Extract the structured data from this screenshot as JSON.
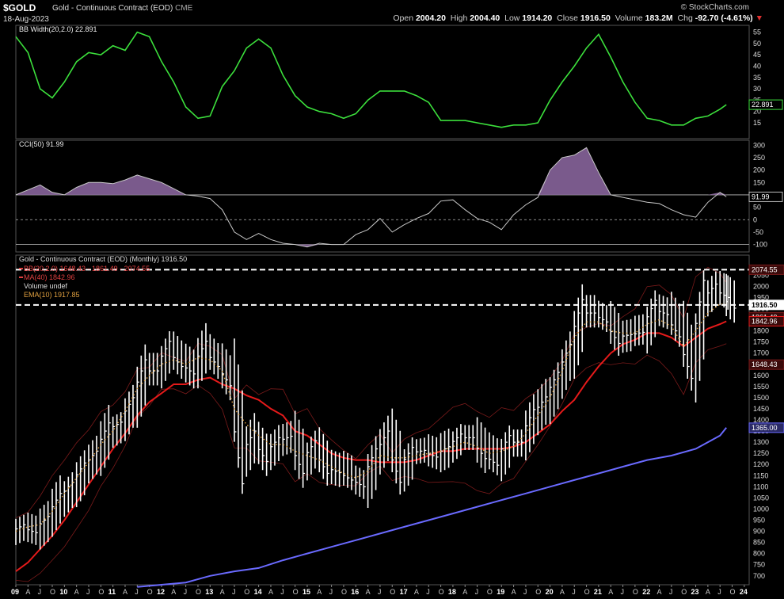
{
  "header": {
    "symbol": "$GOLD",
    "name": "Gold - Continuous Contract (EOD)",
    "exchange": "CME",
    "date": "18-Aug-2023",
    "logo": "© StockCharts.com",
    "ohlc": {
      "open_label": "Open",
      "open": "2004.20",
      "high_label": "High",
      "high": "2004.40",
      "low_label": "Low",
      "low": "1914.20",
      "close_label": "Close",
      "close": "1916.50",
      "volume_label": "Volume",
      "volume": "183.2M",
      "chg_label": "Chg",
      "chg": "-92.70 (-4.61%)"
    },
    "down_arrow_color": "#e03030"
  },
  "chart_data": [
    {
      "type": "line",
      "panel": "BB Width",
      "legend": "BB Width(20,2.0) 22.891",
      "last_value_label": "22.891",
      "color": "#3ce03c",
      "ylim": [
        8,
        58
      ],
      "yticks": [
        15,
        20,
        25,
        30,
        35,
        40,
        45,
        50,
        55
      ],
      "x": [
        2009.0,
        2009.25,
        2009.5,
        2009.75,
        2010.0,
        2010.25,
        2010.5,
        2010.75,
        2011.0,
        2011.25,
        2011.5,
        2011.75,
        2012.0,
        2012.25,
        2012.5,
        2012.75,
        2013.0,
        2013.25,
        2013.5,
        2013.75,
        2014.0,
        2014.25,
        2014.5,
        2014.75,
        2015.0,
        2015.25,
        2015.5,
        2015.75,
        2016.0,
        2016.25,
        2016.5,
        2016.75,
        2017.0,
        2017.25,
        2017.5,
        2017.75,
        2018.0,
        2018.25,
        2018.5,
        2018.75,
        2019.0,
        2019.25,
        2019.5,
        2019.75,
        2020.0,
        2020.25,
        2020.5,
        2020.75,
        2021.0,
        2021.25,
        2021.5,
        2021.75,
        2022.0,
        2022.25,
        2022.5,
        2022.75,
        2023.0,
        2023.25,
        2023.5,
        2023.63
      ],
      "y": [
        53,
        46,
        30,
        26,
        33,
        42,
        46,
        45,
        49,
        47,
        55,
        53,
        42,
        33,
        22,
        17,
        18,
        31,
        38,
        48,
        52,
        48,
        36,
        27,
        22,
        20,
        19,
        17,
        19,
        25,
        29,
        29,
        29,
        27,
        24,
        16,
        16,
        16,
        15,
        14,
        13,
        14,
        14,
        15,
        25,
        33,
        40,
        48,
        54,
        44,
        33,
        24,
        17,
        16,
        14,
        14,
        17,
        18,
        21,
        23
      ]
    },
    {
      "type": "area",
      "panel": "CCI",
      "legend": "CCI(50) 91.99",
      "last_value_label": "91.99",
      "color": "#c8c8c8",
      "fill": "#7a5a8c",
      "ylim": [
        -130,
        320
      ],
      "yticks": [
        -100,
        -50,
        0,
        50,
        100,
        150,
        200,
        250,
        300
      ],
      "x": [
        2009.0,
        2009.25,
        2009.5,
        2009.75,
        2010.0,
        2010.25,
        2010.5,
        2010.75,
        2011.0,
        2011.25,
        2011.5,
        2011.75,
        2012.0,
        2012.25,
        2012.5,
        2012.75,
        2013.0,
        2013.25,
        2013.5,
        2013.75,
        2014.0,
        2014.25,
        2014.5,
        2014.75,
        2015.0,
        2015.25,
        2015.5,
        2015.75,
        2016.0,
        2016.25,
        2016.5,
        2016.75,
        2017.0,
        2017.25,
        2017.5,
        2017.75,
        2018.0,
        2018.25,
        2018.5,
        2018.75,
        2019.0,
        2019.25,
        2019.5,
        2019.75,
        2020.0,
        2020.25,
        2020.5,
        2020.75,
        2021.0,
        2021.25,
        2021.5,
        2021.75,
        2022.0,
        2022.25,
        2022.5,
        2022.75,
        2023.0,
        2023.25,
        2023.5,
        2023.63
      ],
      "y": [
        100,
        120,
        140,
        110,
        100,
        130,
        150,
        150,
        145,
        160,
        180,
        165,
        150,
        125,
        100,
        95,
        85,
        40,
        -50,
        -80,
        -55,
        -80,
        -95,
        -100,
        -110,
        -95,
        -100,
        -100,
        -60,
        -40,
        5,
        -50,
        -20,
        5,
        25,
        75,
        80,
        40,
        5,
        -10,
        -40,
        20,
        60,
        90,
        200,
        250,
        260,
        290,
        190,
        100,
        90,
        80,
        70,
        65,
        40,
        20,
        10,
        70,
        110,
        92
      ]
    },
    {
      "type": "bar",
      "panel": "Price",
      "legend": "Gold - Continuous Contract (EOD) (Monthly) 1916.50",
      "legend_bb": "BB(20,2.0) 1648.43 - 1861.49 - 2074.55",
      "legend_ma": "MA(40) 1842.96",
      "legend_vol": "Volume undef",
      "legend_ema": "EMA(10) 1917.85",
      "ylim": [
        660,
        2140
      ],
      "yticks": [
        700,
        750,
        800,
        850,
        900,
        950,
        1000,
        1050,
        1100,
        1150,
        1200,
        1250,
        1300,
        1350,
        1400,
        1450,
        1500,
        1550,
        1600,
        1650,
        1700,
        1750,
        1800,
        1850,
        1900,
        1950,
        2000,
        2050
      ],
      "xticks": [
        "09",
        "A",
        "J",
        "O",
        "10",
        "A",
        "J",
        "O",
        "11",
        "A",
        "J",
        "O",
        "12",
        "A",
        "J",
        "O",
        "13",
        "A",
        "J",
        "O",
        "14",
        "A",
        "J",
        "O",
        "15",
        "A",
        "J",
        "O",
        "16",
        "A",
        "J",
        "O",
        "17",
        "A",
        "J",
        "O",
        "18",
        "A",
        "J",
        "O",
        "19",
        "A",
        "J",
        "O",
        "20",
        "A",
        "J",
        "O",
        "21",
        "A",
        "J",
        "O",
        "22",
        "A",
        "J",
        "O",
        "23",
        "A",
        "J",
        "O",
        "24"
      ],
      "price_labels": [
        "2074.55",
        "1916.50",
        "1861.49",
        "1842.96",
        "1648.43",
        "1365.00"
      ],
      "x": [
        2009.0,
        2009.25,
        2009.5,
        2009.75,
        2010.0,
        2010.25,
        2010.5,
        2010.75,
        2011.0,
        2011.25,
        2011.5,
        2011.75,
        2012.0,
        2012.25,
        2012.5,
        2012.75,
        2013.0,
        2013.25,
        2013.5,
        2013.75,
        2014.0,
        2014.25,
        2014.5,
        2014.75,
        2015.0,
        2015.25,
        2015.5,
        2015.75,
        2016.0,
        2016.25,
        2016.5,
        2016.75,
        2017.0,
        2017.25,
        2017.5,
        2017.75,
        2018.0,
        2018.25,
        2018.5,
        2018.75,
        2019.0,
        2019.25,
        2019.5,
        2019.75,
        2020.0,
        2020.25,
        2020.5,
        2020.75,
        2021.0,
        2021.25,
        2021.5,
        2021.75,
        2022.0,
        2022.25,
        2022.5,
        2022.75,
        2023.0,
        2023.25,
        2023.5,
        2023.63
      ],
      "close": [
        920,
        900,
        950,
        1040,
        1100,
        1180,
        1240,
        1350,
        1380,
        1470,
        1620,
        1620,
        1720,
        1660,
        1620,
        1720,
        1660,
        1580,
        1230,
        1320,
        1240,
        1300,
        1320,
        1200,
        1280,
        1190,
        1170,
        1140,
        1110,
        1230,
        1320,
        1170,
        1250,
        1260,
        1240,
        1270,
        1320,
        1320,
        1250,
        1210,
        1300,
        1300,
        1410,
        1480,
        1580,
        1700,
        1880,
        1880,
        1850,
        1770,
        1780,
        1790,
        1900,
        1880,
        1800,
        1640,
        1930,
        1990,
        1960,
        1916.5
      ],
      "ema10": [
        900,
        920,
        930,
        990,
        1070,
        1140,
        1210,
        1290,
        1350,
        1440,
        1540,
        1600,
        1650,
        1670,
        1650,
        1680,
        1670,
        1620,
        1450,
        1380,
        1330,
        1290,
        1290,
        1260,
        1240,
        1220,
        1190,
        1160,
        1140,
        1170,
        1240,
        1230,
        1230,
        1240,
        1250,
        1260,
        1280,
        1300,
        1280,
        1250,
        1260,
        1280,
        1340,
        1420,
        1500,
        1620,
        1770,
        1840,
        1840,
        1800,
        1790,
        1790,
        1830,
        1850,
        1820,
        1730,
        1800,
        1880,
        1920,
        1917.85
      ],
      "ma40": [
        720,
        760,
        820,
        880,
        950,
        1030,
        1110,
        1190,
        1270,
        1340,
        1420,
        1480,
        1520,
        1560,
        1560,
        1580,
        1590,
        1560,
        1540,
        1510,
        1490,
        1450,
        1420,
        1350,
        1330,
        1290,
        1250,
        1230,
        1220,
        1220,
        1210,
        1210,
        1210,
        1220,
        1240,
        1260,
        1260,
        1270,
        1270,
        1270,
        1270,
        1280,
        1300,
        1340,
        1380,
        1440,
        1490,
        1570,
        1640,
        1700,
        1740,
        1760,
        1790,
        1790,
        1770,
        1730,
        1770,
        1810,
        1830,
        1842.96
      ],
      "ma200": [
        650,
        660,
        670,
        700,
        720,
        735,
        770,
        800,
        830,
        860,
        890,
        920,
        950,
        980,
        1010,
        1040,
        1070,
        1100,
        1130,
        1160,
        1190,
        1220,
        1240,
        1270,
        1300,
        1330,
        1365
      ],
      "ma200_x": [
        2011.5,
        2012.0,
        2012.5,
        2013.0,
        2013.5,
        2014.0,
        2014.5,
        2015.0,
        2015.5,
        2016.0,
        2016.5,
        2017.0,
        2017.5,
        2018.0,
        2018.5,
        2019.0,
        2019.5,
        2020.0,
        2020.5,
        2021.0,
        2021.5,
        2022.0,
        2022.5,
        2023.0,
        2023.25,
        2023.5,
        2023.63
      ],
      "colors": {
        "ma40": "#e51a1a",
        "ma200": "#6a6aff",
        "ema10": "#e0a040",
        "bb": "#7a1a1a",
        "bars": "#ffffff"
      }
    }
  ]
}
